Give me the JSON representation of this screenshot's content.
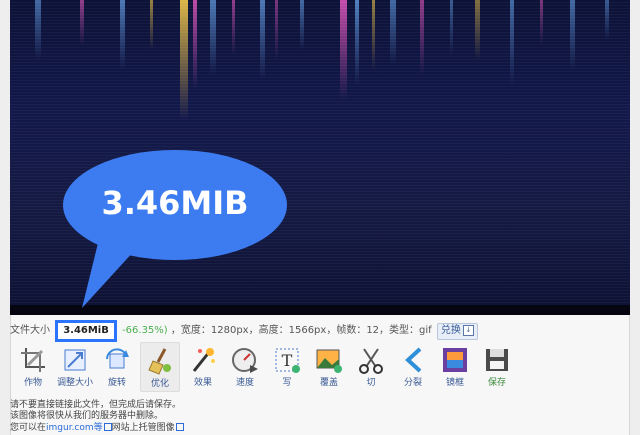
{
  "bubble": {
    "text": "3.46MIB",
    "color": "#3d7cf0"
  },
  "info": {
    "prefix": "文件大小",
    "size_value": "3.46MiB",
    "percent": "-66.35%)",
    "rest": "，宽度：1280px，高度：1566px，帧数：12，类型：gif",
    "convert_label": "兑换",
    "download_icon": "download-icon"
  },
  "toolbar": {
    "tools": [
      {
        "label": "作物",
        "icon": "crop-icon"
      },
      {
        "label": "调整大小",
        "icon": "resize-icon"
      },
      {
        "label": "旋转",
        "icon": "rotate-icon"
      },
      {
        "label": "优化",
        "icon": "broom-icon"
      },
      {
        "label": "效果",
        "icon": "magic-wand-icon"
      },
      {
        "label": "速度",
        "icon": "speed-icon"
      },
      {
        "label": "写",
        "icon": "text-icon"
      },
      {
        "label": "覆盖",
        "icon": "overlay-icon"
      },
      {
        "label": "切",
        "icon": "scissors-icon"
      },
      {
        "label": "分裂",
        "icon": "split-icon"
      },
      {
        "label": "镜框",
        "icon": "frame-icon"
      },
      {
        "label": "保存",
        "icon": "save-icon"
      }
    ]
  },
  "footer": {
    "line1": "请不要直接链接此文件，但完成后请保存。",
    "line2": "该图像将很快从我们的服务器中删除。",
    "line3_prefix": "您可以在",
    "line3_link1": "imgur.com等",
    "line3_link2": "网站上托管图像"
  }
}
